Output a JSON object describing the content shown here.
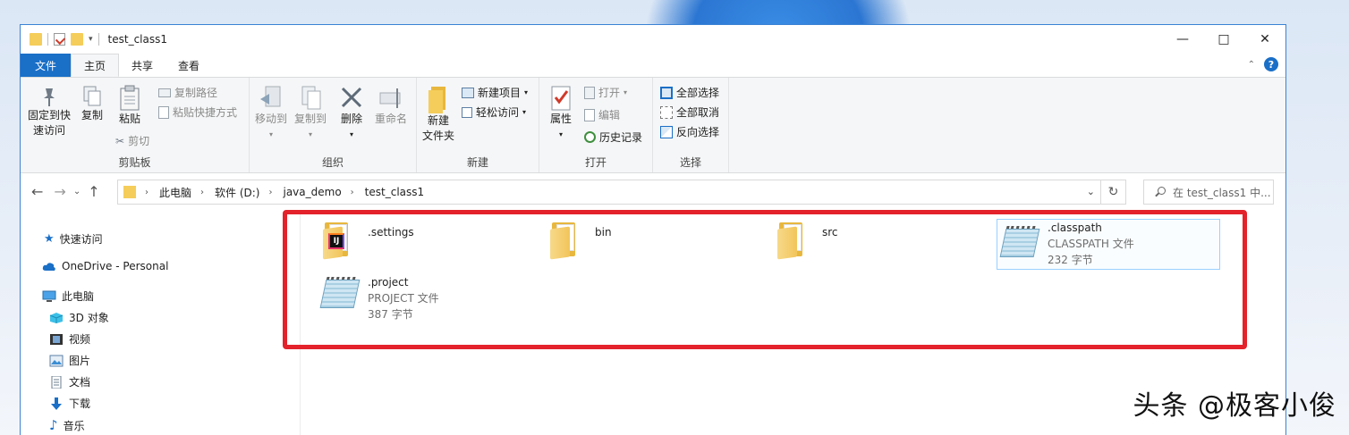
{
  "window": {
    "title": "test_class1"
  },
  "ribbon_tabs": [
    "文件",
    "主页",
    "共享",
    "查看"
  ],
  "ribbon": {
    "clipboard": {
      "pin": "固定到快速访问",
      "pin_line1": "固定到快",
      "pin_line2": "速访问",
      "copy": "复制",
      "paste": "粘贴",
      "copy_path": "复制路径",
      "paste_shortcut": "粘贴快捷方式",
      "cut": "剪切",
      "label": "剪贴板"
    },
    "organize": {
      "move_to": "移动到",
      "copy_to": "复制到",
      "delete": "删除",
      "rename": "重命名",
      "label": "组织"
    },
    "new": {
      "new_folder_line1": "新建",
      "new_folder_line2": "文件夹",
      "new_item": "新建项目",
      "easy_access": "轻松访问",
      "label": "新建"
    },
    "open": {
      "properties": "属性",
      "open": "打开",
      "edit": "编辑",
      "history": "历史记录",
      "label": "打开"
    },
    "select": {
      "select_all": "全部选择",
      "select_none": "全部取消",
      "invert": "反向选择",
      "label": "选择"
    }
  },
  "address": {
    "breadcrumbs": [
      "此电脑",
      "软件 (D:)",
      "java_demo",
      "test_class1"
    ]
  },
  "search": {
    "placeholder": "在 test_class1 中..."
  },
  "nav_pane": [
    {
      "label": "快速访问",
      "icon": "star-icon"
    },
    {
      "label": "OneDrive - Personal",
      "icon": "cloud-icon"
    },
    {
      "label": "此电脑",
      "icon": "computer-icon"
    },
    {
      "label": "3D 对象",
      "icon": "cube-icon"
    },
    {
      "label": "视频",
      "icon": "video-icon"
    },
    {
      "label": "图片",
      "icon": "picture-icon"
    },
    {
      "label": "文档",
      "icon": "document-icon"
    },
    {
      "label": "下载",
      "icon": "download-icon"
    },
    {
      "label": "音乐",
      "icon": "music-icon"
    }
  ],
  "files": [
    {
      "name": ".settings",
      "type": "",
      "size": "",
      "icon": "intellij-folder-icon"
    },
    {
      "name": "bin",
      "type": "",
      "size": "",
      "icon": "folder-icon"
    },
    {
      "name": "src",
      "type": "",
      "size": "",
      "icon": "folder-icon"
    },
    {
      "name": ".classpath",
      "type": "CLASSPATH 文件",
      "size": "232 字节",
      "icon": "notepad-icon"
    },
    {
      "name": ".project",
      "type": "PROJECT 文件",
      "size": "387 字节",
      "icon": "notepad-icon"
    }
  ],
  "watermark": "头条 @极客小俊",
  "colors": {
    "accent": "#1a6fc7",
    "highlight_border": "#e3222b",
    "folder": "#f2c55a"
  }
}
